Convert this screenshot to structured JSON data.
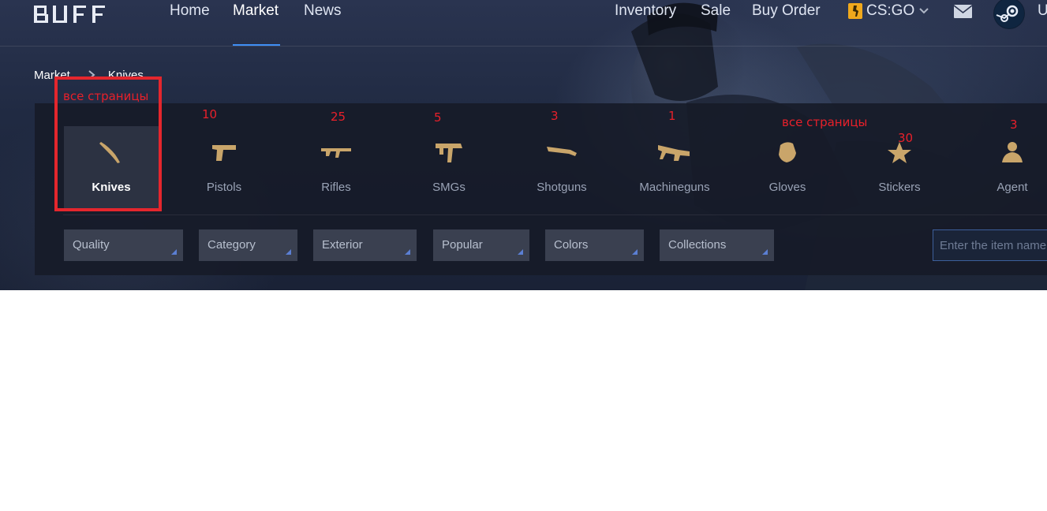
{
  "nav": {
    "logo": "BUFF",
    "left_items": [
      "Home",
      "Market",
      "News"
    ],
    "active_item": "Market",
    "right_items": [
      "Inventory",
      "Sale",
      "Buy Order"
    ],
    "game": "CS:GO",
    "user_initial": "U"
  },
  "breadcrumb": [
    "Market",
    "Knives"
  ],
  "categories": [
    {
      "label": "Knives",
      "icon": "knife-icon",
      "active": true
    },
    {
      "label": "Pistols",
      "icon": "pistol-icon",
      "active": false
    },
    {
      "label": "Rifles",
      "icon": "rifle-icon",
      "active": false
    },
    {
      "label": "SMGs",
      "icon": "smg-icon",
      "active": false
    },
    {
      "label": "Shotguns",
      "icon": "shotgun-icon",
      "active": false
    },
    {
      "label": "Machineguns",
      "icon": "machinegun-icon",
      "active": false
    },
    {
      "label": "Gloves",
      "icon": "glove-icon",
      "active": false
    },
    {
      "label": "Stickers",
      "icon": "sticker-icon",
      "active": false
    },
    {
      "label": "Agent",
      "icon": "agent-icon",
      "active": false
    }
  ],
  "filters": [
    "Quality",
    "Category",
    "Exterior",
    "Popular",
    "Colors",
    "Collections"
  ],
  "search": {
    "placeholder": "Enter the item name"
  },
  "annotations": {
    "knives": "все страницы",
    "pistols": "10",
    "rifles": "25",
    "smgs": "5",
    "shotguns": "3",
    "machineguns": "1",
    "gloves": "все страницы",
    "stickers": "30",
    "agent": "3"
  },
  "colors": {
    "accent": "#3f8ef5",
    "icon_gold": "#c9a56a",
    "annotation_red": "#e8202a",
    "panel": "#161b28"
  }
}
